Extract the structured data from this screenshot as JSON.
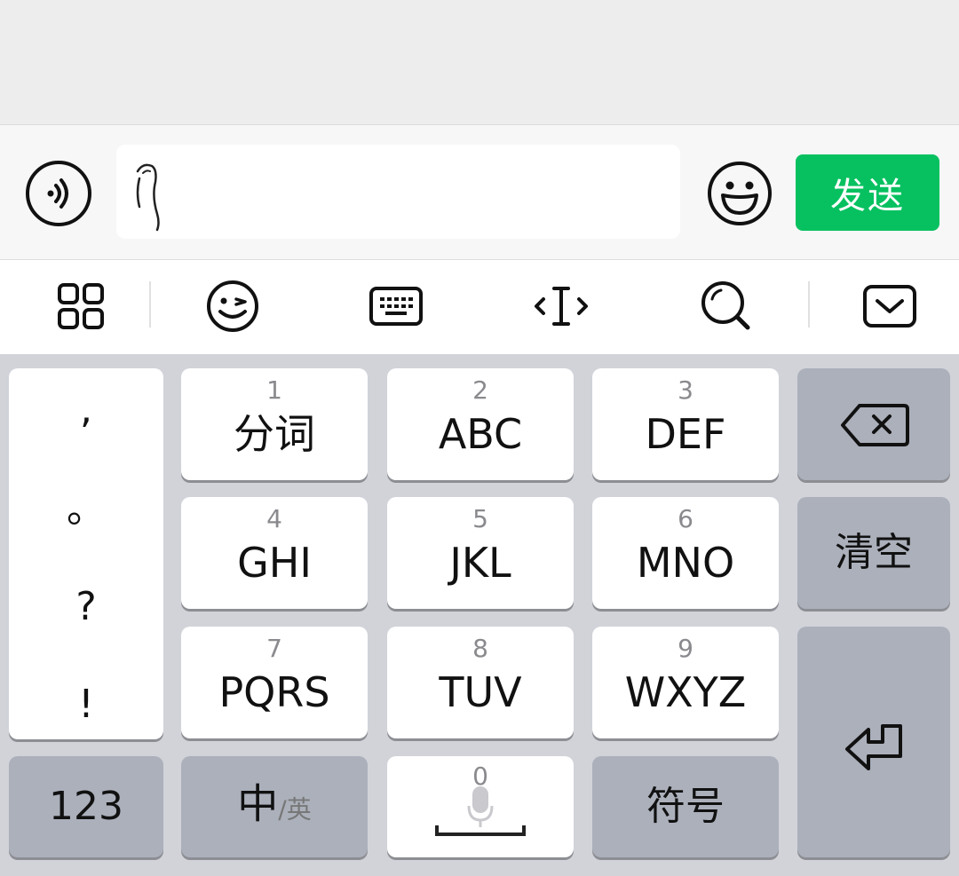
{
  "input_bar": {
    "voice_icon": "voice-wave-icon",
    "input_value": "",
    "emoji_icon": "smiley-icon",
    "send_label": "发送"
  },
  "toolbar": {
    "icons": [
      "grid-apps-icon",
      "wink-emoji-icon",
      "keyboard-icon",
      "cursor-move-icon",
      "search-icon",
      "collapse-keyboard-icon"
    ]
  },
  "keyboard": {
    "punctuation": [
      ",",
      "。",
      "?",
      "!"
    ],
    "keys": [
      {
        "num": "1",
        "label": "分词"
      },
      {
        "num": "2",
        "label": "ABC"
      },
      {
        "num": "3",
        "label": "DEF"
      },
      {
        "num": "4",
        "label": "GHI"
      },
      {
        "num": "5",
        "label": "JKL"
      },
      {
        "num": "6",
        "label": "MNO"
      },
      {
        "num": "7",
        "label": "PQRS"
      },
      {
        "num": "8",
        "label": "TUV"
      },
      {
        "num": "9",
        "label": "WXYZ"
      }
    ],
    "backspace_icon": "backspace-icon",
    "clear_label": "清空",
    "enter_icon": "return-icon",
    "num_mode_label": "123",
    "zh_label": "中",
    "en_label": "/英",
    "space_num": "0",
    "mic_icon": "microphone-icon",
    "symbol_label": "符号",
    "colors": {
      "send": "#07c160",
      "key_white": "#ffffff",
      "key_gray": "#abb0bb"
    }
  }
}
